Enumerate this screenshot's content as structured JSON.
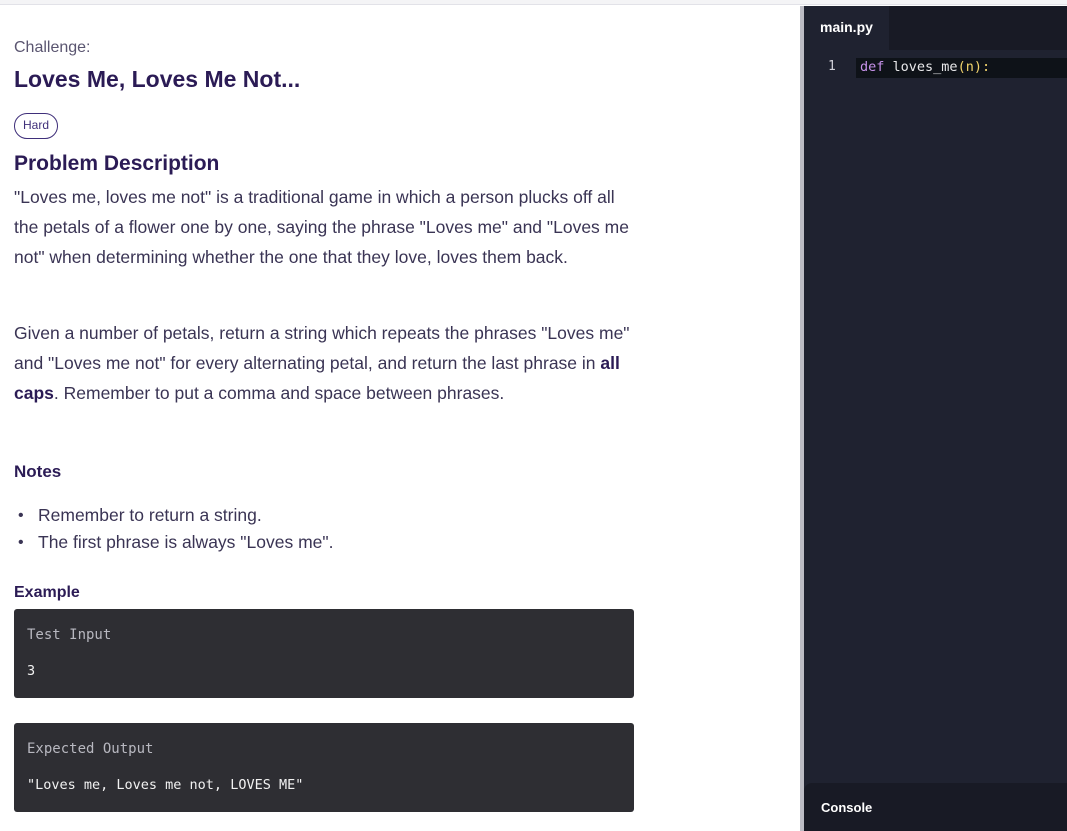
{
  "problem": {
    "challenge_label": "Challenge:",
    "title": "Loves Me, Loves Me Not...",
    "difficulty": "Hard",
    "description_heading": "Problem Description",
    "paragraph1": "\"Loves me, loves me not\" is a traditional game in which a person plucks off all the petals of a flower one by one, saying the phrase \"Loves me\" and \"Loves me not\" when determining whether the one that they love, loves them back.",
    "paragraph2_before": "Given a number of petals, return a string which repeats the phrases \"Loves me\" and \"Loves me not\" for every alternating petal, and return the last phrase in ",
    "paragraph2_bold": "all caps",
    "paragraph2_after": ". Remember to put a comma and space between phrases.",
    "notes_heading": "Notes",
    "notes": [
      "Remember to return a string.",
      "The first phrase is always \"Loves me\"."
    ],
    "example_heading": "Example",
    "test_input_label": "Test Input",
    "test_input_value": "3",
    "expected_output_label": "Expected Output",
    "expected_output_value": "\"Loves me, Loves me not, LOVES ME\""
  },
  "editor": {
    "tab_label": "main.py",
    "line_number": "1",
    "code_keyword": "def",
    "code_function": "loves_me",
    "code_params": "(n):",
    "console_label": "Console"
  },
  "colors": {
    "heading": "#2b1b55",
    "editor_bg": "#1f2230",
    "code_box_bg": "#2e2e33",
    "keyword": "#c792ea"
  }
}
